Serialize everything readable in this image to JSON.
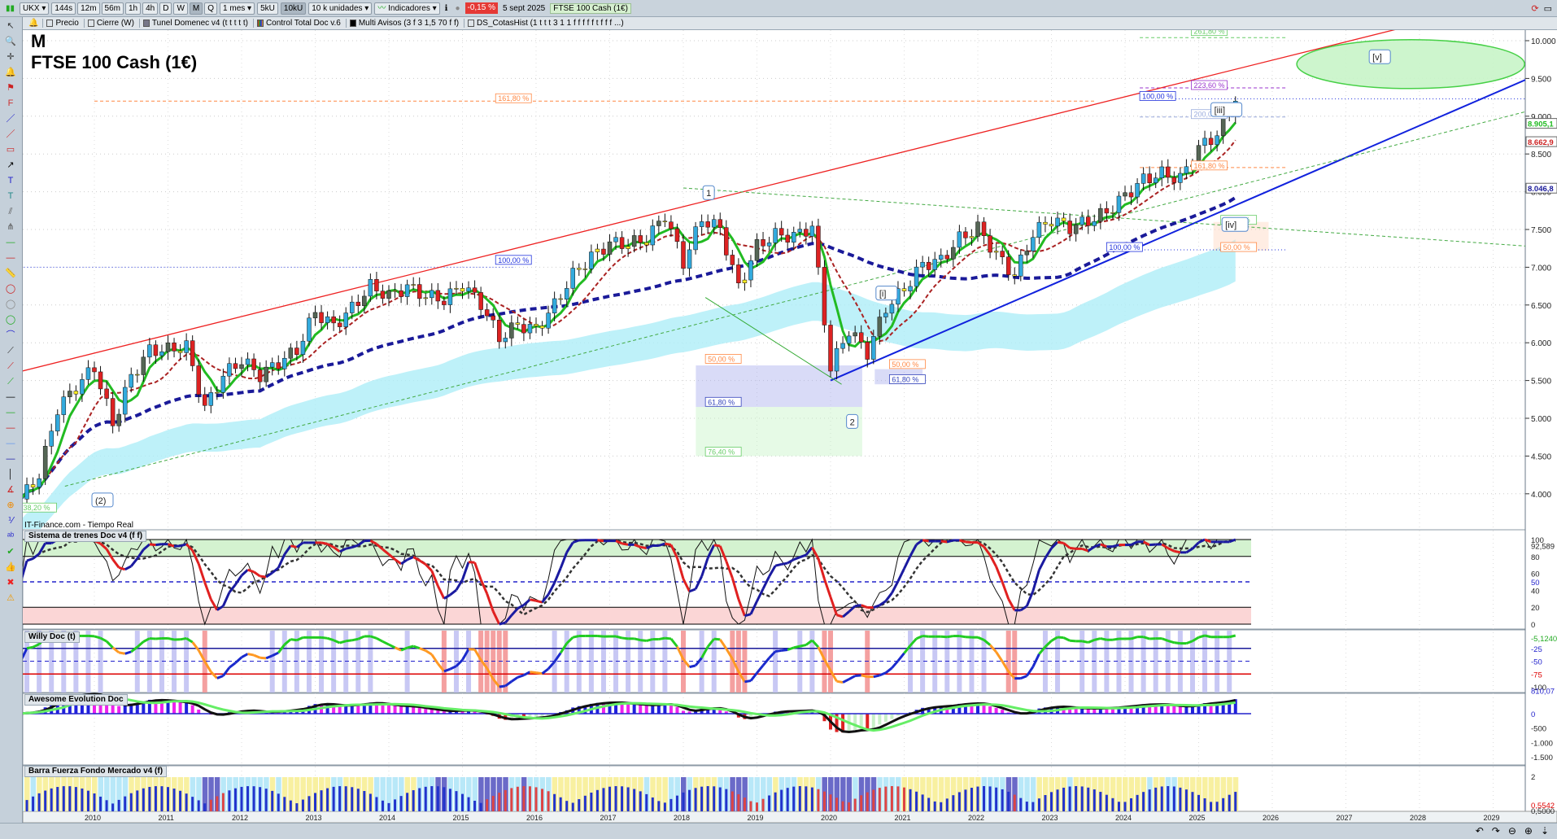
{
  "toolbar": {
    "symbol": "UKX",
    "timeframes": [
      "144s",
      "12m",
      "56m",
      "1h",
      "4h",
      "D",
      "W",
      "M",
      "Q"
    ],
    "active_timeframe": "M",
    "period": "1 mes",
    "units": [
      "5kU",
      "10kU"
    ],
    "active_unit": "10kU",
    "units_select": "10 k unidades",
    "indicators_label": "Indicadores",
    "change": "-0,15 %",
    "date": "5 sept 2025",
    "instrument": "FTSE 100 Cash (1€)"
  },
  "indicator_bar": [
    "Precio",
    "Cierre (W)",
    "Tunel Domenec v4 (t t t t t)",
    "Control Total Doc v.6",
    "Multi Avisos (3 f 3 1,5 70 f f)",
    "DS_CotasHist (1 t t t 3 1 1 f f f f f t f f f ...)"
  ],
  "chart": {
    "period_letter": "M",
    "title": "FTSE 100 Cash (1€)",
    "source": "IT-Finance.com - Tiempo Real"
  },
  "price_axis": {
    "ticks": [
      "10.000",
      "9.500",
      "9.000",
      "8.500",
      "8.000",
      "7.500",
      "7.000",
      "6.500",
      "6.000",
      "5.500",
      "5.000",
      "4.500",
      "4.000"
    ],
    "markers": [
      {
        "label": "8.905,1",
        "color": "#22bb22"
      },
      {
        "label": "8.662,9",
        "color": "#cc2222"
      },
      {
        "label": "8.046,8",
        "color": "#1a1a99"
      }
    ]
  },
  "panels": [
    {
      "title": "Sistema de trenes Doc v4 (f f)",
      "axis": [
        "100",
        "92,589",
        "80",
        "60",
        "50",
        "40",
        "20",
        "0"
      ]
    },
    {
      "title": "Willy Doc (t)",
      "axis": [
        "-5,1240",
        "-25",
        "-50",
        "-75",
        "-100"
      ]
    },
    {
      "title": "Awesome Evolution Doc",
      "axis": [
        "810,07",
        "0",
        "-500",
        "-1.000",
        "-1.500"
      ]
    },
    {
      "title": "Barra Fuerza Fondo Mercado v4 (f)",
      "axis": [
        "2",
        "0,5542",
        "0,5000"
      ]
    }
  ],
  "x_axis": [
    "2010",
    "2011",
    "2012",
    "2013",
    "2014",
    "2015",
    "2016",
    "2017",
    "2018",
    "2019",
    "2020",
    "2021",
    "2022",
    "2023",
    "2024",
    "2025",
    "2026",
    "2027",
    "2028",
    "2029"
  ],
  "chart_data": {
    "type": "candlestick",
    "frequency": "quarterly closes (approx.)",
    "start": 2009.0,
    "closes": [
      3930,
      4250,
      5130,
      5410,
      5680,
      4920,
      5550,
      5900,
      5910,
      5950,
      5130,
      5570,
      5770,
      5570,
      5740,
      5900,
      6410,
      6220,
      6460,
      6750,
      6620,
      6740,
      6620,
      6570,
      6770,
      6520,
      6060,
      6240,
      6170,
      6500,
      6900,
      7140,
      7320,
      7310,
      7370,
      7690,
      7060,
      7640,
      7510,
      6730,
      7280,
      7430,
      7410,
      7540,
      5670,
      6170,
      5870,
      6460,
      6710,
      7040,
      7090,
      7380,
      7520,
      7170,
      6890,
      7450,
      7630,
      7530,
      7610,
      7730,
      7950,
      8160,
      8240,
      8170,
      8580,
      8760,
      9200
    ],
    "ylim": [
      3600,
      10300
    ],
    "xlim": [
      2009.0,
      2029.6
    ],
    "fib_labels": [
      {
        "text": "261,80 %",
        "t": 2024.9,
        "p": 10090,
        "color": "#66cc66"
      },
      {
        "text": "223,60 %",
        "t": 2024.9,
        "p": 9375,
        "color": "#9933cc"
      },
      {
        "text": "100,00 %",
        "t": 2024.2,
        "p": 9230,
        "color": "#2233dd"
      },
      {
        "text": "200,00 %",
        "t": 2024.9,
        "p": 8990,
        "color": "#99aadd"
      },
      {
        "text": "161,80 %",
        "t": 2024.9,
        "p": 8310,
        "color": "#ff8844"
      },
      {
        "text": "161,80 %",
        "t": 2015.45,
        "p": 9200,
        "color": "#ff8844"
      },
      {
        "text": "100,00 %",
        "t": 2015.45,
        "p": 7060,
        "color": "#2233dd"
      },
      {
        "text": "100,00 %",
        "t": 2023.75,
        "p": 7230,
        "color": "#2233dd"
      },
      {
        "text": "38,20 %",
        "t": 2025.3,
        "p": 7590,
        "color": "#66cc66"
      },
      {
        "text": "50,00 %",
        "t": 2025.3,
        "p": 7230,
        "color": "#ff8844"
      },
      {
        "text": "50,00 %",
        "t": 2018.3,
        "p": 5750,
        "color": "#ff8844"
      },
      {
        "text": "61,80 %",
        "t": 2018.3,
        "p": 5180,
        "color": "#3344bb"
      },
      {
        "text": "76,40 %",
        "t": 2018.3,
        "p": 4520,
        "color": "#66cc66"
      },
      {
        "text": "50,00 %",
        "t": 2020.8,
        "p": 5680,
        "color": "#ff8844"
      },
      {
        "text": "61,80 %",
        "t": 2020.8,
        "p": 5480,
        "color": "#3344bb"
      },
      {
        "text": "38,20 %",
        "t": 2009.0,
        "p": 3780,
        "color": "#66cc66"
      }
    ],
    "wave_labels": [
      {
        "text": "1",
        "t": 2018.3,
        "p": 7950
      },
      {
        "text": "2",
        "t": 2020.25,
        "p": 4920
      },
      {
        "text": "(2)",
        "t": 2010.0,
        "p": 3880
      },
      {
        "text": "[i]",
        "t": 2020.65,
        "p": 6620
      },
      {
        "text": "[iii]",
        "t": 2025.2,
        "p": 9050
      },
      {
        "text": "[iv]",
        "t": 2025.35,
        "p": 7530
      },
      {
        "text": "[v]",
        "t": 2027.35,
        "p": 9750
      }
    ]
  },
  "colors": {
    "up": "#33aadd",
    "down": "#dd2222",
    "neutral": "#556655",
    "doji": "#ffee22",
    "resistance": "#ee2222",
    "support": "#1122dd"
  }
}
